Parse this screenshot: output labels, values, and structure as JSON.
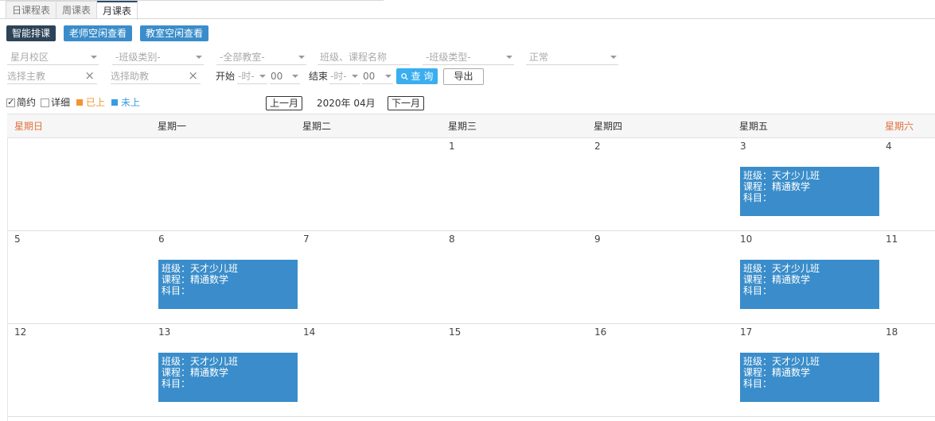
{
  "tabs": [
    {
      "label": "日课程表",
      "active": false
    },
    {
      "label": "周课表",
      "active": false
    },
    {
      "label": "月课表",
      "active": true
    }
  ],
  "actions": {
    "smart_schedule": "智能排课",
    "teacher_free": "老师空闲查看",
    "room_free": "教室空闲查看"
  },
  "filters": {
    "campus": "星月校区",
    "class_category": "-班级类别-",
    "classroom": "-全部教室-",
    "name_placeholder": "班级、课程名称",
    "class_type": "-班级类型-",
    "status": "正常",
    "main_teacher": "选择主教",
    "assistant": "选择助教",
    "start_label": "开始",
    "end_label": "结束",
    "hour_placeholder": "-时-",
    "minute_value": "00",
    "clear_icon": "×",
    "search_label": "查 询",
    "export_label": "导出"
  },
  "legend": {
    "brief": "简约",
    "detail": "详细",
    "done": "已上",
    "todo": "未上",
    "done_color": "#f0962e",
    "todo_color": "#3a9be0"
  },
  "month_nav": {
    "prev": "上一月",
    "current": "2020年 04月",
    "next": "下一月"
  },
  "weekdays": [
    "星期日",
    "星期一",
    "星期二",
    "星期三",
    "星期四",
    "星期五",
    "星期六"
  ],
  "weeks": [
    [
      "",
      "",
      "",
      "1",
      "2",
      "3",
      "4"
    ],
    [
      "5",
      "6",
      "7",
      "8",
      "9",
      "10",
      "11"
    ],
    [
      "12",
      "13",
      "14",
      "15",
      "16",
      "17",
      "18"
    ]
  ],
  "events": [
    {
      "date": "3",
      "class": "班级：天才少儿班",
      "course": "课程：精通数学",
      "subject": "科目："
    },
    {
      "date": "6",
      "class": "班级：天才少儿班",
      "course": "课程：精通数学",
      "subject": "科目："
    },
    {
      "date": "10",
      "class": "班级：天才少儿班",
      "course": "课程：精通数学",
      "subject": "科目："
    },
    {
      "date": "13",
      "class": "班级：天才少儿班",
      "course": "课程：精通数学",
      "subject": "科目："
    },
    {
      "date": "17",
      "class": "班级：天才少儿班",
      "course": "课程：精通数学",
      "subject": "科目："
    }
  ],
  "colors": {
    "event_bg": "#3a8dca",
    "weekend_text": "#e0703d",
    "dark_button": "#2d4358",
    "search_button": "#3aaef0"
  }
}
